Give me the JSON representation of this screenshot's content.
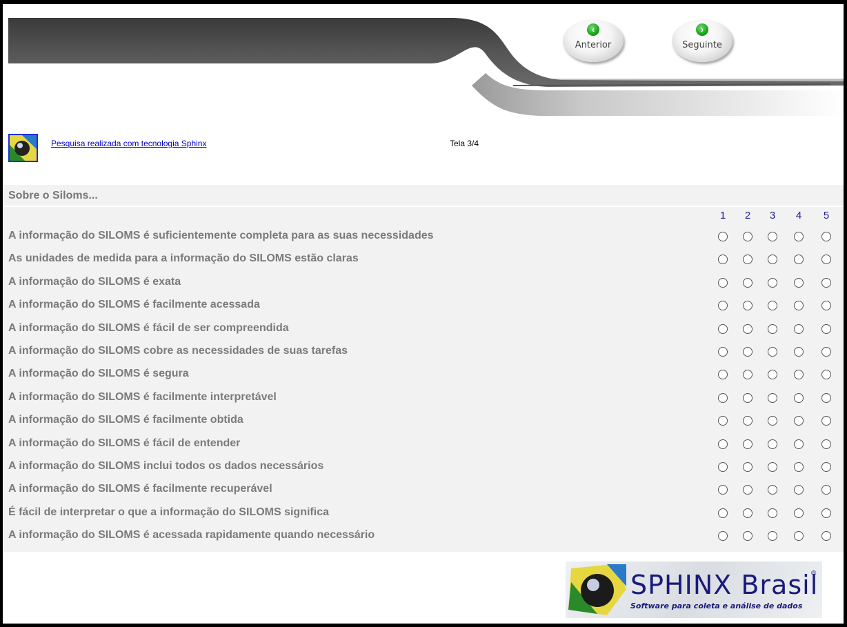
{
  "nav": {
    "prev_label": "Anterior",
    "next_label": "Seguinte"
  },
  "header": {
    "sphinx_link": "Pesquisa realizada com tecnologia Sphinx",
    "screen_indicator": "Tela 3/4"
  },
  "survey": {
    "section_title": "Sobre o Siloms...",
    "scale": [
      "1",
      "2",
      "3",
      "4",
      "5"
    ],
    "questions": [
      "A informação do SILOMS é suficientemente completa para as suas necessidades",
      "As unidades de medida para a informação do SILOMS estão claras",
      "A informação do SILOMS é exata",
      "A informação do SILOMS é facilmente acessada",
      "A informação do SILOMS é fácil de ser compreendida",
      "A informação do SILOMS cobre as necessidades de suas tarefas",
      "A informação do SILOMS é segura",
      "A informação do SILOMS é facilmente interpretável",
      "A informação do SILOMS é facilmente obtida",
      "A informação do SILOMS é fácil de entender",
      "A informação do SILOMS inclui todos os dados necessários",
      "A informação do SILOMS é facilmente recuperável",
      "É fácil de interpretar o que a informação do SILOMS significa",
      "A informação do SILOMS é acessada rapidamente quando necessário"
    ]
  },
  "footer": {
    "brand": "SPHINX Brasil",
    "registered": "®",
    "tagline": "Software para coleta e análise de dados"
  },
  "icons": {
    "prev": "arrow-left-icon",
    "next": "arrow-right-icon",
    "logo": "sphinx-logo-icon"
  },
  "colors": {
    "link": "#0000cc",
    "question_text": "#7a7a7a",
    "scale_numbers": "#20208a",
    "survey_bg": "#f2f2f2"
  }
}
